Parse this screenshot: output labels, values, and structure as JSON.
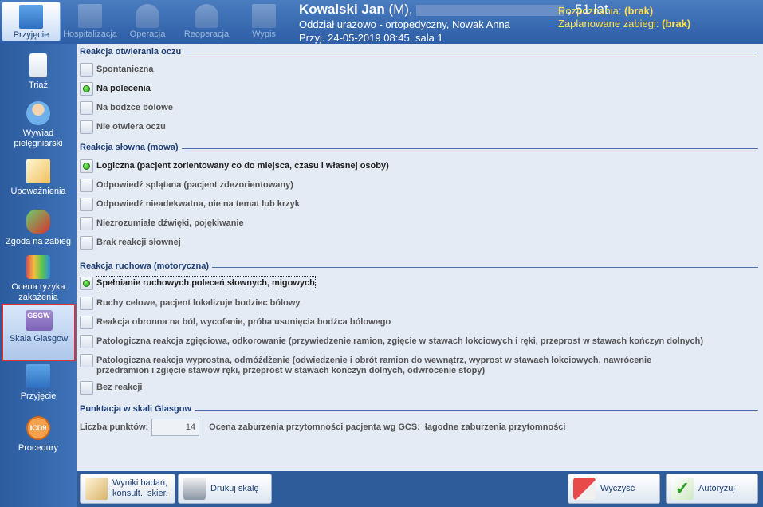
{
  "toolbar": {
    "items": [
      {
        "label": "Przyjęcie",
        "active": true
      },
      {
        "label": "Hospitalizacja",
        "active": false
      },
      {
        "label": "Operacja",
        "active": false
      },
      {
        "label": "Reoperacja",
        "active": false
      },
      {
        "label": "Wypis",
        "active": false
      }
    ]
  },
  "patient": {
    "name": "Kowalski Jan",
    "sex": "(M),",
    "age": ", 51 lat",
    "department": "Oddział urazowo - ortopedyczny, Nowak Anna",
    "admission": "Przyj. 24-05-2019 08:45, sala 1",
    "diagnosis_label": "Rozpoznania:",
    "diagnosis_value": "(brak)",
    "planned_label": "Zaplanowane zabiegi:",
    "planned_value": "(brak)"
  },
  "sidebar": {
    "items": [
      {
        "label": "Triaż"
      },
      {
        "label": "Wywiad pielęgniarski"
      },
      {
        "label": "Upoważnienia"
      },
      {
        "label": "Zgoda na zabieg"
      },
      {
        "label": "Ocena ryzyka zakażenia"
      },
      {
        "label": "Skala Glasgow",
        "icon_text": "GSGW",
        "active": true
      },
      {
        "label": "Przyjęcie"
      },
      {
        "label": "Procedury",
        "icon_text": "ICD9"
      }
    ]
  },
  "sections": {
    "eye": {
      "title": "Reakcja otwierania oczu",
      "options": [
        "Spontaniczna",
        "Na polecenia",
        "Na bodźce bólowe",
        "Nie otwiera oczu"
      ],
      "selected": "Na polecenia"
    },
    "verbal": {
      "title": "Reakcja słowna (mowa)",
      "options": [
        "Logiczna (pacjent zorientowany co do miejsca, czasu i własnej osoby)",
        "Odpowiedź splątana (pacjent zdezorientowany)",
        "Odpowiedź nieadekwatna, nie na temat lub krzyk",
        "Niezrozumiałe dźwięki, pojękiwanie",
        "Brak reakcji słownej"
      ],
      "selected": "Logiczna (pacjent zorientowany co do miejsca, czasu i własnej osoby)"
    },
    "motor": {
      "title": "Reakcja ruchowa (motoryczna)",
      "options": [
        "Spełnianie ruchowych poleceń słownych, migowych",
        "Ruchy celowe, pacjent lokalizuje bodziec bólowy",
        "Reakcja obronna na ból, wycofanie, próba usunięcia bodźca bólowego",
        "Patologiczna reakcja zgięciowa, odkorowanie (przywiedzenie ramion, zgięcie w stawach łokciowych i ręki, przeprost w stawach kończyn dolnych)",
        "Patologiczna reakcja wyprostna, odmóżdżenie (odwiedzenie i obrót ramion do wewnątrz, wyprost w stawach łokciowych, nawrócenie przedramion i zgięcie stawów ręki, przeprost w stawach kończyn dolnych, odwrócenie stopy)",
        "Bez reakcji"
      ],
      "selected": "Spełnianie ruchowych poleceń słownych, migowych"
    },
    "score": {
      "title": "Punktacja w skali Glasgow",
      "points_label": "Liczba punktów:",
      "points_value": "14",
      "gcs_label": "Ocena zaburzenia przytomności pacjenta wg GCS:",
      "gcs_value": "łagodne zaburzenia przytomności"
    }
  },
  "buttons": {
    "results": "Wyniki badań, konsult., skier.",
    "print": "Drukuj skalę",
    "clear": "Wyczyść",
    "authorize": "Autoryzuj"
  },
  "colors": {
    "header_bg": "#2d5ea6",
    "panel_bg": "#e4ebf5",
    "highlight_text": "#ffe24a",
    "selected_dot": "#1c9a12",
    "active_border": "#e03030"
  }
}
